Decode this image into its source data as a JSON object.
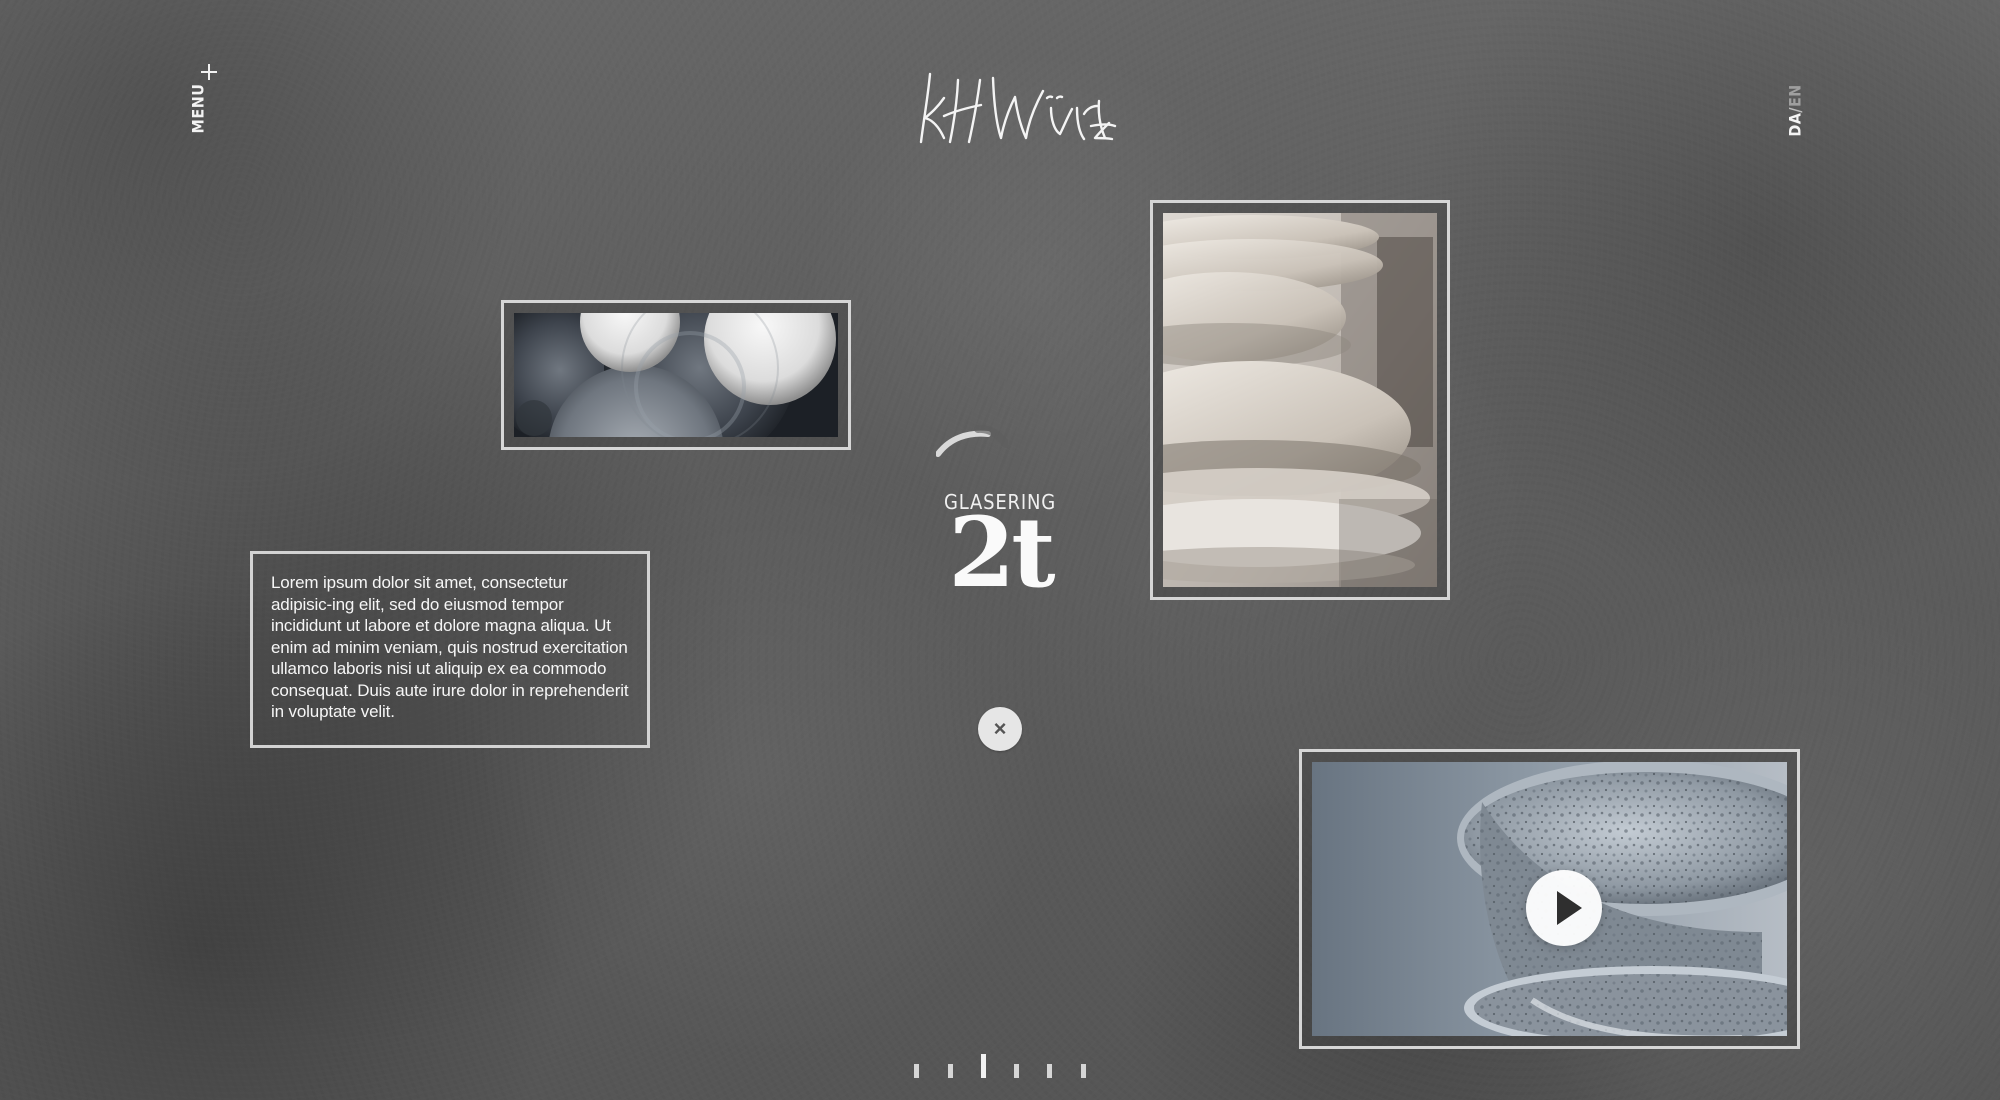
{
  "header": {
    "menu_label": "MENU",
    "logo_text": "KH Würtz",
    "language": {
      "active": "DA",
      "separator": "/",
      "inactive": "EN"
    }
  },
  "content": {
    "text_box": "Lorem ipsum dolor sit amet, consectetur adipisic-ing elit, sed do eiusmod tempor incididunt ut labore et dolore magna aliqua. Ut enim ad minim veniam, quis nostrud exercitation ullamco laboris nisi ut aliquip ex ea commodo consequat. Duis aute irure dolor in reprehenderit in voluptate velit.",
    "section_label": "GLASERING",
    "big_value": "2t"
  },
  "icons": {
    "menu_toggle": "plus-icon",
    "close": "close-icon",
    "video_play": "play-icon"
  },
  "colors": {
    "background": "#5b5b5b",
    "frame": "#d6d6d6",
    "text": "#f2f2f2"
  }
}
